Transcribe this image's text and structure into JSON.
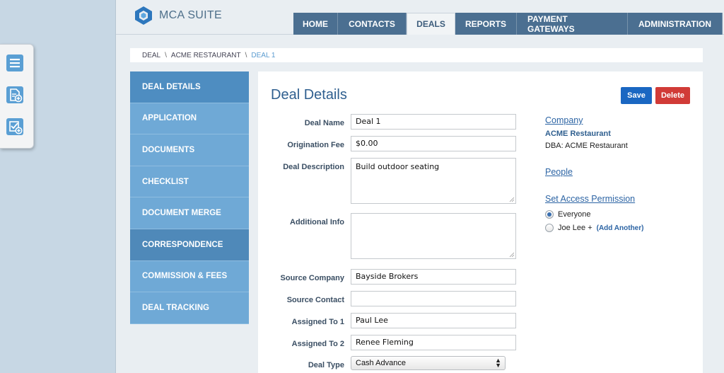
{
  "app": {
    "logo_text": "MCA SUITE",
    "accent": "#4b6f91",
    "highlight": "#6fa9d6"
  },
  "toolbox": {
    "icons": [
      "menu-icon",
      "add-document-icon",
      "add-checklist-icon"
    ]
  },
  "nav": {
    "tabs": [
      {
        "label": "HOME"
      },
      {
        "label": "CONTACTS"
      },
      {
        "label": "DEALS",
        "active": true
      },
      {
        "label": "REPORTS"
      },
      {
        "label": "PAYMENT GATEWAYS"
      },
      {
        "label": "ADMINISTRATION"
      }
    ]
  },
  "breadcrumb": {
    "items": [
      "DEAL",
      "ACME RESTAURANT",
      "DEAL 1"
    ],
    "separator": "\\"
  },
  "sidebar": {
    "items": [
      {
        "label": "DEAL DETAILS",
        "active": true
      },
      {
        "label": "APPLICATION"
      },
      {
        "label": "DOCUMENTS"
      },
      {
        "label": "CHECKLIST"
      },
      {
        "label": "DOCUMENT MERGE"
      },
      {
        "label": "CORRESPONDENCE"
      },
      {
        "label": "COMMISSION & FEES"
      },
      {
        "label": "DEAL TRACKING"
      }
    ]
  },
  "page": {
    "title": "Deal Details",
    "save_label": "Save",
    "delete_label": "Delete"
  },
  "form": {
    "deal_name": {
      "label": "Deal Name",
      "value": "Deal 1"
    },
    "origination_fee": {
      "label": "Origination Fee",
      "value": "$0.00"
    },
    "deal_description": {
      "label": "Deal Description",
      "value": "Build outdoor seating"
    },
    "additional_info": {
      "label": "Additional Info",
      "value": ""
    },
    "source_company": {
      "label": "Source Company",
      "value": "Bayside Brokers"
    },
    "source_contact": {
      "label": "Source Contact",
      "value": ""
    },
    "assigned_to_1": {
      "label": "Assigned To 1",
      "value": "Paul Lee"
    },
    "assigned_to_2": {
      "label": "Assigned To 2",
      "value": "Renee Fleming"
    },
    "deal_type": {
      "label": "Deal Type",
      "value": "Cash Advance"
    }
  },
  "company": {
    "heading": "Company",
    "name": "ACME Restaurant",
    "dba": "DBA: ACME Restaurant"
  },
  "people": {
    "heading": "People"
  },
  "access": {
    "heading": "Set Access Permission",
    "options": [
      {
        "label": "Everyone",
        "selected": true
      },
      {
        "label": "Joe Lee +",
        "selected": false
      }
    ],
    "add_another": "(Add Another)"
  }
}
